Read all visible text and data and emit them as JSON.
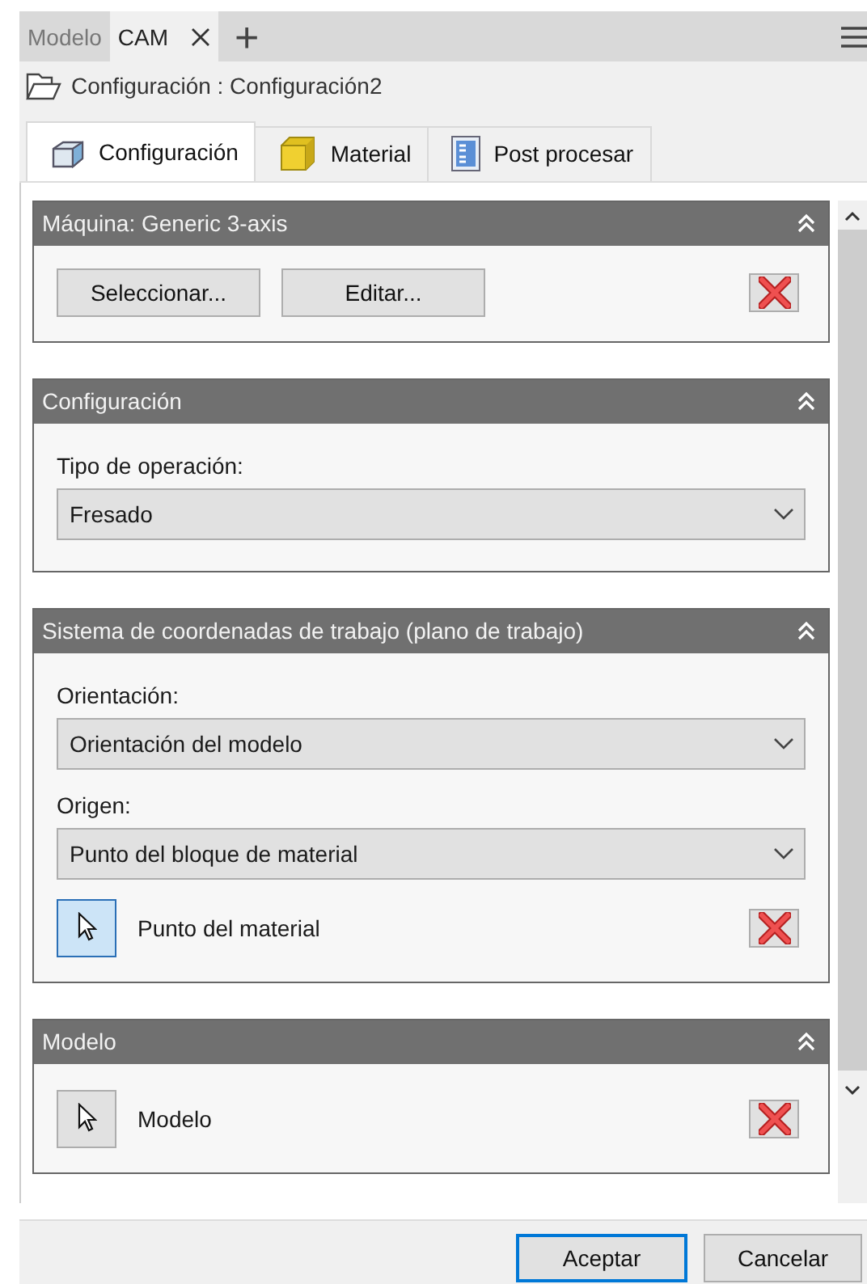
{
  "doc_tabs": [
    {
      "label": "Modelo",
      "selected": false,
      "closable": false
    },
    {
      "label": "CAM",
      "selected": true,
      "closable": true
    }
  ],
  "add_tab": "+",
  "breadcrumb": "Configuración : Configuración2",
  "tabs": [
    {
      "label": "Configuración",
      "selected": true,
      "kind": "cube"
    },
    {
      "label": "Material",
      "selected": false,
      "kind": "block"
    },
    {
      "label": "Post procesar",
      "selected": false,
      "kind": "gcode"
    }
  ],
  "sections": [
    {
      "title": "Máquina: Generic 3-axis",
      "expanded": true,
      "items": [
        {
          "kind": "buttons",
          "buttons": [
            "Seleccionar...",
            "Editar..."
          ]
        }
      ]
    },
    {
      "title": "Configuración",
      "expanded": true,
      "items": [
        {
          "kind": "label",
          "text": "Tipo de operación:"
        },
        {
          "kind": "dropdown",
          "value": "Fresado"
        }
      ]
    },
    {
      "title": "Sistema de coordenadas de trabajo (plano de trabajo)",
      "expanded": true,
      "items": [
        {
          "kind": "label",
          "text": "Orientación:"
        },
        {
          "kind": "dropdown",
          "value": "Orientación del modelo"
        },
        {
          "kind": "label",
          "text": "Origen:"
        },
        {
          "kind": "dropdown",
          "value": "Punto del bloque de material"
        },
        {
          "kind": "picker",
          "text": "Punto del material",
          "selected": true
        }
      ]
    },
    {
      "title": "Modelo",
      "expanded": true,
      "items": [
        {
          "kind": "picker",
          "text": "Modelo",
          "selected": false
        }
      ]
    }
  ],
  "footer_buttons": [
    {
      "label": "Aceptar",
      "default": true
    },
    {
      "label": "Cancelar",
      "default": false
    }
  ]
}
